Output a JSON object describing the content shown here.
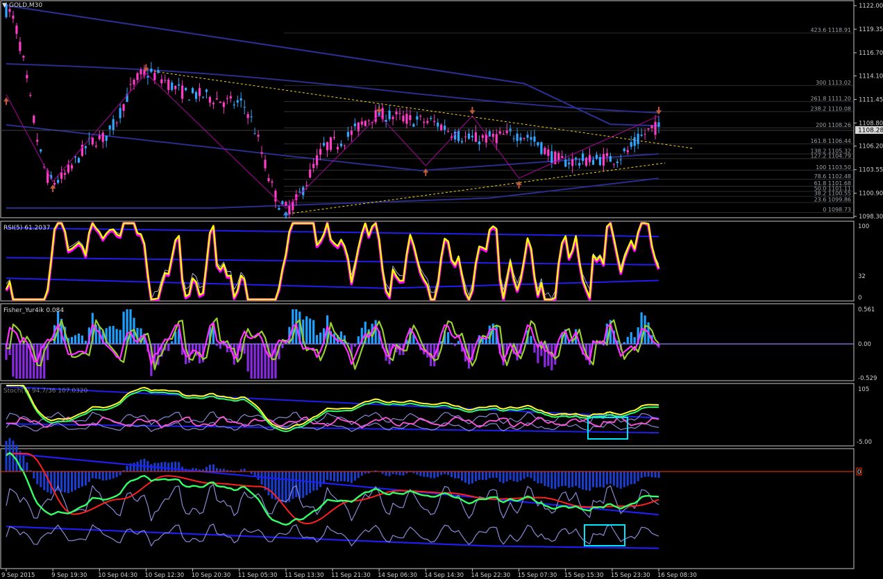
{
  "window_title": "GOLD,M30",
  "colors": {
    "background": "#000000",
    "frame": "#c8c8c8",
    "bull_candle": "#33a6ff",
    "bear_candle": "#ff3cc8",
    "envelope": "#2a2d8c",
    "envelope_bright": "#1e1ef0",
    "fib_line": "#4a4a4a",
    "trend_line": "#ffd700",
    "zigzag": "#b000a0",
    "arrow_up": "#2f8ee8",
    "arrow_down": "#c05a3a",
    "rsi_main": "#ffff00",
    "rsi_under": "#ff00ff",
    "fisher_line_a": "#ff30ff",
    "fisher_line_b": "#9acd32",
    "hist_pos": "#1ea0ff",
    "hist_neg": "#8a2be2",
    "stoch_main": "#ffff33",
    "stoch_sig": "#33ff66",
    "highlight_box": "#00e5ff",
    "zero_line_red": "#ff3300"
  },
  "main_panel": {
    "price_axis": [
      "1122.00",
      "1119.35",
      "1116.70",
      "1114.10",
      "1111.45",
      "1108.80",
      "1106.20",
      "1103.55",
      "1100.90",
      "1098.30"
    ],
    "y_range": [
      1098.3,
      1122.4
    ],
    "current_price": "1108.28",
    "fib_levels": [
      {
        "ratio": "423.6",
        "price": "1118.91",
        "value": 1118.91
      },
      {
        "ratio": "300",
        "price": "1113.02",
        "value": 1113.02
      },
      {
        "ratio": "261.8",
        "price": "1111.20",
        "value": 1111.2
      },
      {
        "ratio": "238.2",
        "price": "1110.08",
        "value": 1110.08
      },
      {
        "ratio": "200",
        "price": "1108.26",
        "value": 1108.26
      },
      {
        "ratio": "161.8",
        "price": "1106.44",
        "value": 1106.44
      },
      {
        "ratio": "138.2",
        "price": "1105.32",
        "value": 1105.32
      },
      {
        "ratio": "127.2",
        "price": "1104.79",
        "value": 1104.79
      },
      {
        "ratio": "100",
        "price": "1103.50",
        "value": 1103.5
      },
      {
        "ratio": "78.6",
        "price": "1102.48",
        "value": 1102.48
      },
      {
        "ratio": "61.8",
        "price": "1101.68",
        "value": 1101.68
      },
      {
        "ratio": "50.0",
        "price": "1101.11",
        "value": 1101.11
      },
      {
        "ratio": "38.2",
        "price": "1100.55",
        "value": 1100.55
      },
      {
        "ratio": "23.6",
        "price": "1099.86",
        "value": 1099.86
      },
      {
        "ratio": "0",
        "price": "1098.73",
        "value": 1098.73
      }
    ]
  },
  "rsi_panel": {
    "title": "RSI(5) 61.2037",
    "levels": [
      "100",
      "32",
      "0"
    ]
  },
  "fisher_panel": {
    "title": "Fisher_Yur4ik 0.084",
    "levels": [
      "0.561",
      "0.00",
      "-0.529"
    ]
  },
  "stoch_panel": {
    "title": "Stoch(7) 94.7/36 107.0320",
    "levels": [
      "105",
      "-5.00"
    ]
  },
  "bottom_panel": {
    "level": "0"
  },
  "time_axis": [
    "9 Sep 2015",
    "9 Sep 19:30",
    "10 Sep 04:30",
    "10 Sep 12:30",
    "10 Sep 20:30",
    "11 Sep 05:30",
    "11 Sep 13:30",
    "11 Sep 21:30",
    "14 Sep 06:30",
    "14 Sep 14:30",
    "14 Sep 22:30",
    "15 Sep 07:30",
    "15 Sep 15:30",
    "15 Sep 23:30",
    "16 Sep 08:30"
  ],
  "chart_data": {
    "type": "line",
    "title": "GOLD,M30",
    "x_categories": [
      "9 Sep 2015",
      "9 Sep 19:30",
      "10 Sep 04:30",
      "10 Sep 12:30",
      "10 Sep 20:30",
      "11 Sep 05:30",
      "11 Sep 13:30",
      "11 Sep 21:30",
      "14 Sep 06:30",
      "14 Sep 14:30",
      "14 Sep 22:30",
      "15 Sep 07:30",
      "15 Sep 15:30",
      "15 Sep 23:30",
      "16 Sep 08:30"
    ],
    "ylim": [
      1098.3,
      1122.4
    ],
    "series": [
      {
        "values": [
          1121.5,
          1102.2,
          1107.0,
          1114.4,
          1112.0,
          1111.0,
          1099.2,
          1106.5,
          1109.7,
          1109.0,
          1107.0,
          1107.5,
          1104.5,
          1104.8,
          1108.3
        ]
      }
    ],
    "zigzag_points": [
      {
        "x": "9 Sep 2015",
        "price": 1112.0
      },
      {
        "x": "9 Sep 19:30",
        "price": 1102.2
      },
      {
        "x": "10 Sep 12:30",
        "price": 1114.4
      },
      {
        "x": "11 Sep 13:30",
        "price": 1099.2
      },
      {
        "x": "14 Sep 06:30",
        "price": 1109.7
      },
      {
        "x": "14 Sep 14:30",
        "price": 1104.0
      },
      {
        "x": "14 Sep 22:30",
        "price": 1109.6
      },
      {
        "x": "15 Sep 07:30",
        "price": 1102.6
      },
      {
        "x": "16 Sep 08:30",
        "price": 1109.6
      }
    ],
    "grid": false,
    "legend": "none"
  }
}
